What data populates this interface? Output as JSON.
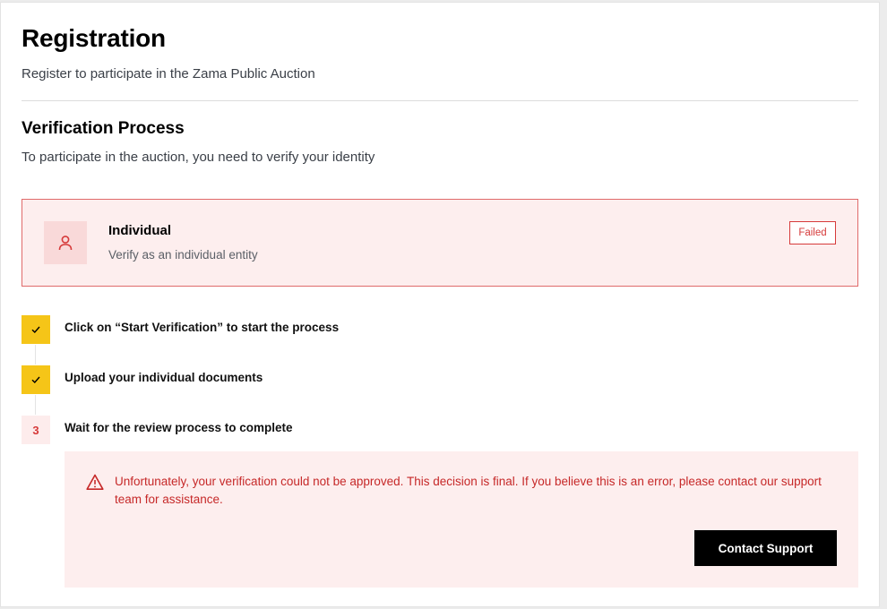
{
  "header": {
    "title": "Registration",
    "subtitle": "Register to participate in the Zama Public Auction"
  },
  "verification": {
    "title": "Verification Process",
    "description": "To participate in the auction, you need to verify your identity"
  },
  "entity_card": {
    "icon": "user-icon",
    "title": "Individual",
    "description": "Verify as an individual entity",
    "status": "Failed"
  },
  "steps": [
    {
      "state": "done",
      "icon": "check-icon",
      "label": "Click on “Start Verification” to start the process"
    },
    {
      "state": "done",
      "icon": "check-icon",
      "label": "Upload your individual documents"
    },
    {
      "state": "failed",
      "number": "3",
      "label": "Wait for the review process to complete"
    }
  ],
  "error": {
    "icon": "warning-icon",
    "message": "Unfortunately, your verification could not be approved. This decision is final. If you believe this is an error, please contact our support team for assistance.",
    "button_label": "Contact Support"
  },
  "colors": {
    "accent_yellow": "#f5c518",
    "error_red": "#d63a3a",
    "error_bg": "#fdeeee",
    "primary_button": "#000000"
  }
}
